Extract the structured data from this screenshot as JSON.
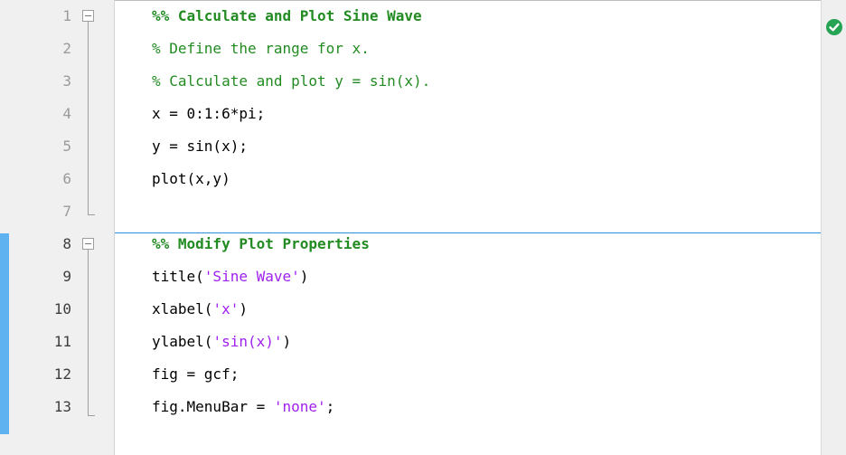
{
  "editor": {
    "sections": [
      {
        "lines": [
          {
            "number": "1",
            "text": "%% Calculate and Plot Sine Wave",
            "kind": "section-title"
          },
          {
            "number": "2",
            "text": "% Define the range for x.",
            "kind": "comment"
          },
          {
            "number": "3",
            "text": "% Calculate and plot y = sin(x).",
            "kind": "comment"
          },
          {
            "number": "4",
            "text": "x = 0:1:6*pi;",
            "kind": "code"
          },
          {
            "number": "5",
            "text": "y = sin(x);",
            "kind": "code"
          },
          {
            "number": "6",
            "text": "plot(x,y)",
            "kind": "code"
          },
          {
            "number": "7",
            "text": "",
            "kind": "code"
          }
        ]
      },
      {
        "lines": [
          {
            "number": "8",
            "text": "%% Modify Plot Properties",
            "kind": "section-title"
          },
          {
            "number": "9",
            "pre": "title(",
            "str": "'Sine Wave'",
            "post": ")"
          },
          {
            "number": "10",
            "pre": "xlabel(",
            "str": "'x'",
            "post": ")"
          },
          {
            "number": "11",
            "pre": "ylabel(",
            "str": "'sin(x)'",
            "post": ")"
          },
          {
            "number": "12",
            "text": "fig = gcf;",
            "kind": "code"
          },
          {
            "number": "13",
            "pre": "fig.MenuBar = ",
            "str": "'none'",
            "post": ";"
          }
        ]
      }
    ],
    "status": {
      "icon": "check-circle-icon",
      "color": "#26a353"
    },
    "colors": {
      "comment": "#228b22",
      "string": "#a020f0",
      "section_indicator": "#5eb2ef",
      "section_divider": "#2e8fd8"
    }
  }
}
